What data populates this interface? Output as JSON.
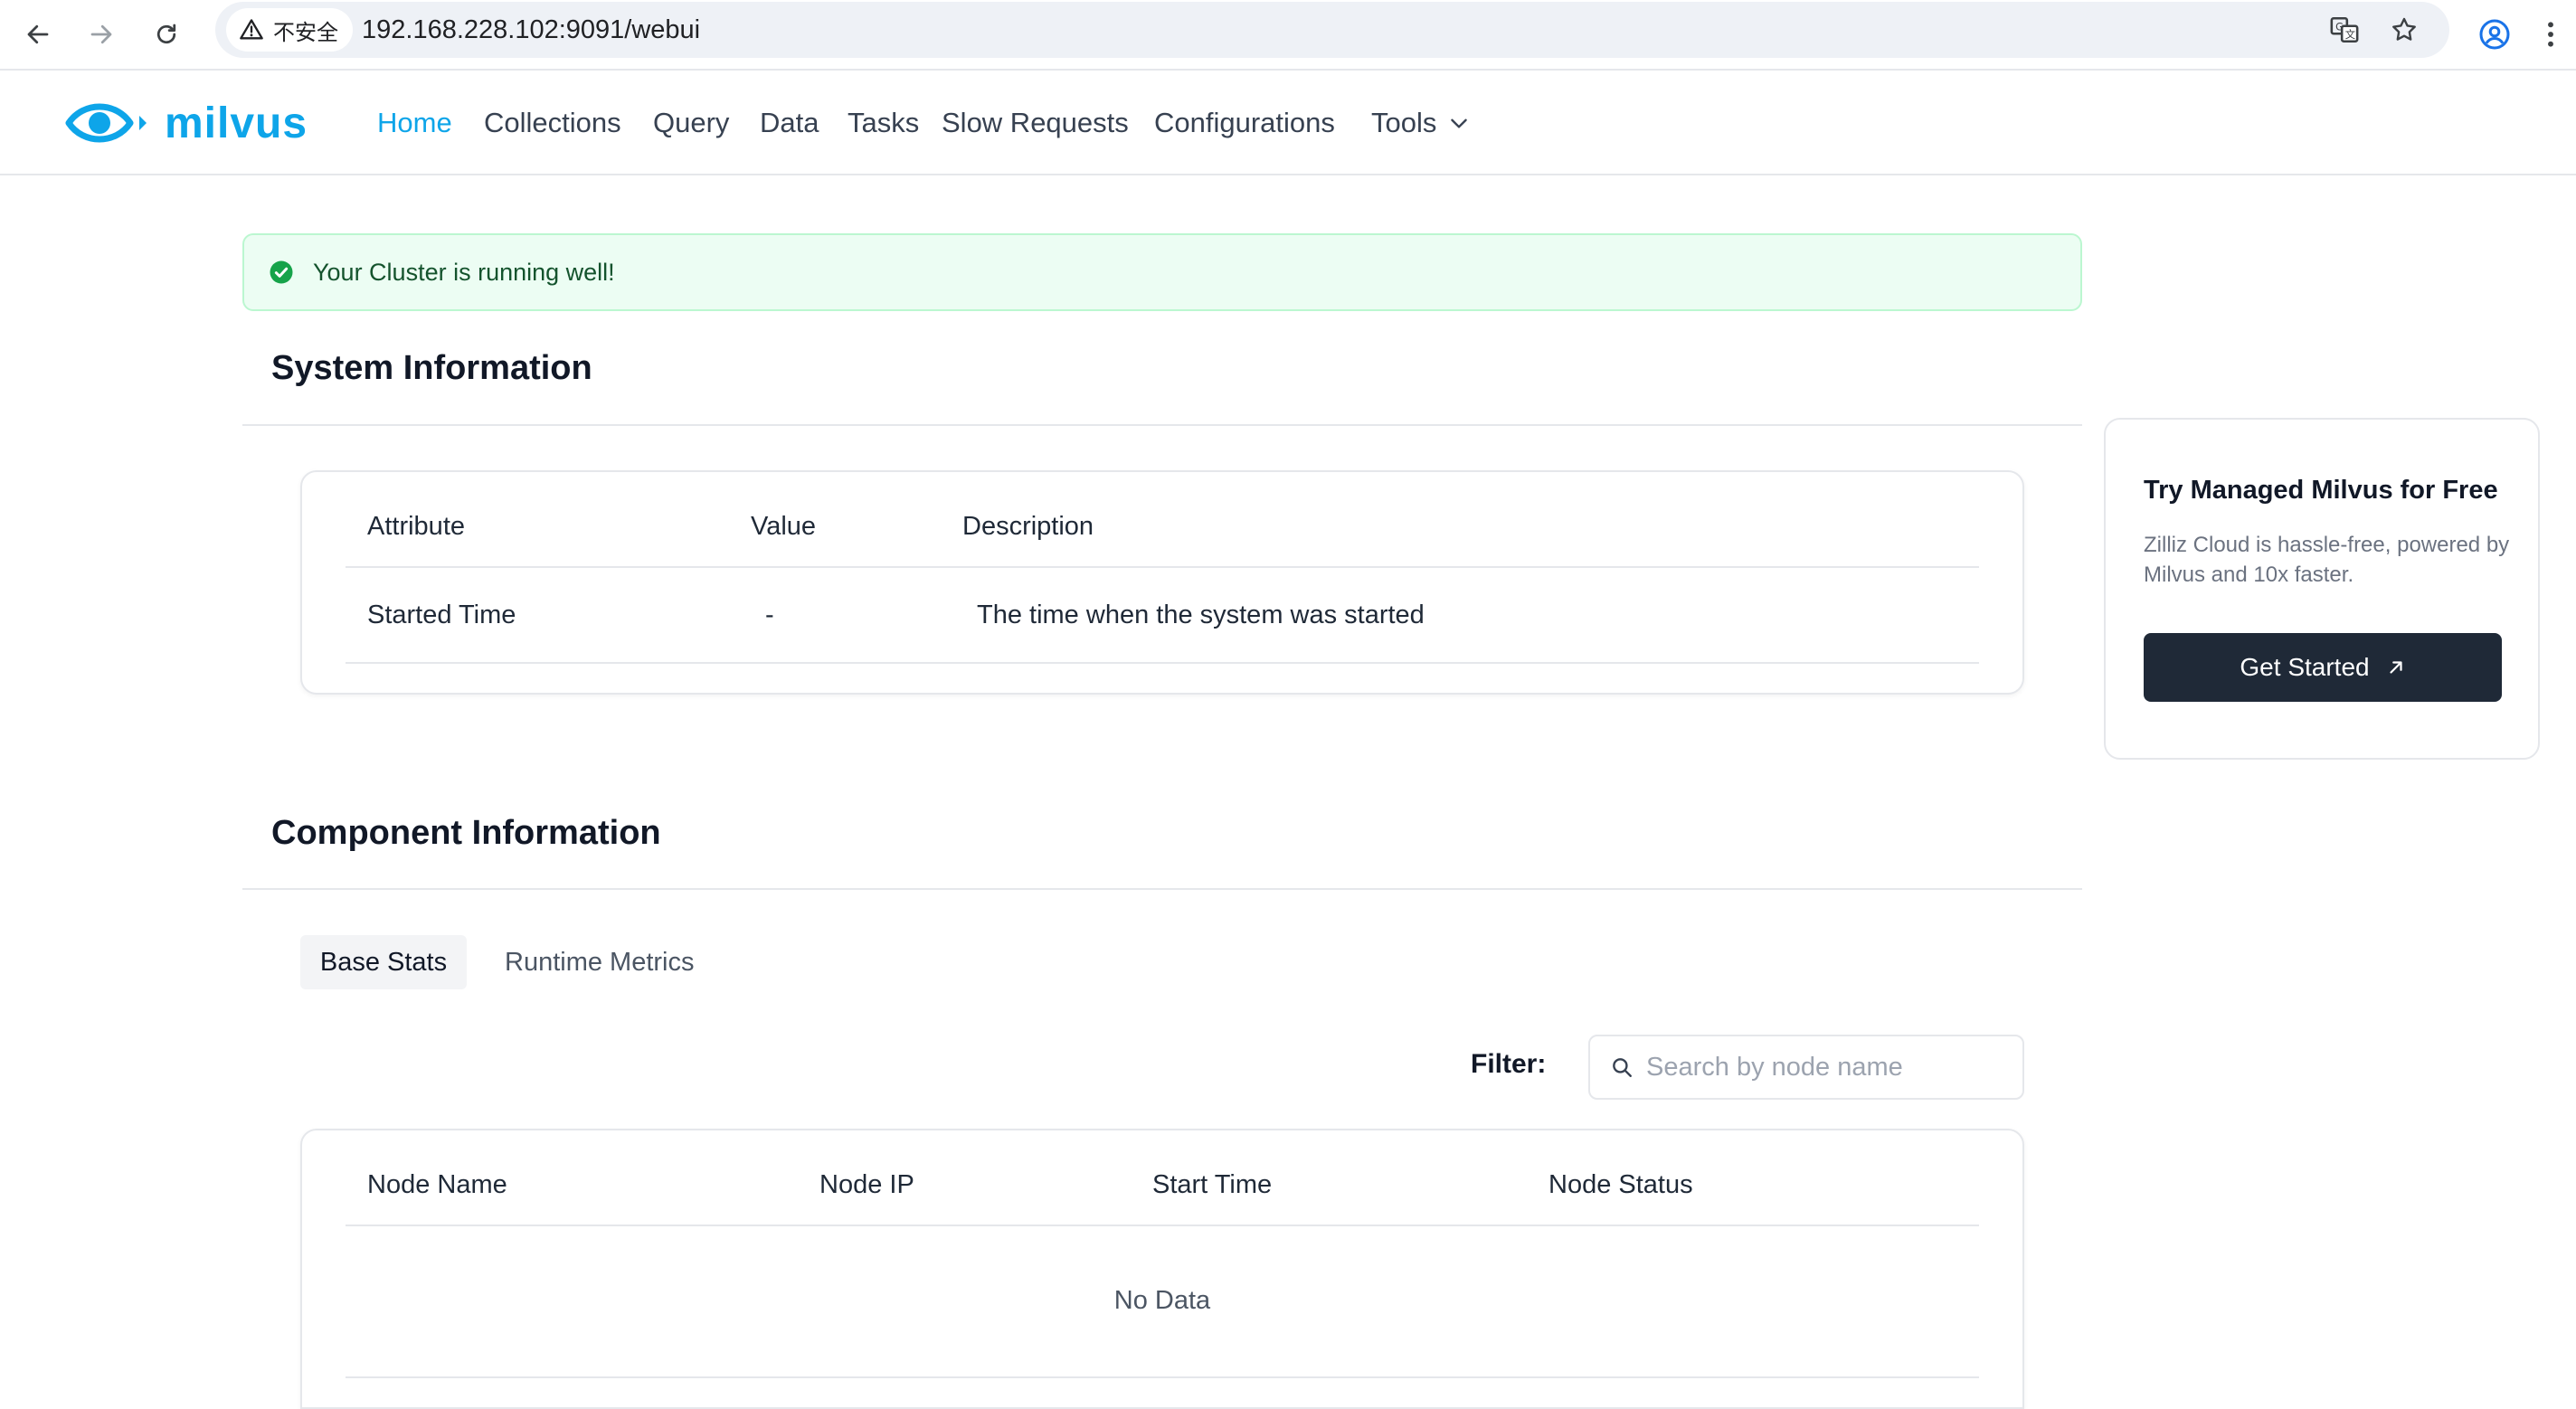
{
  "browser": {
    "security_label": "不安全",
    "url": "192.168.228.102:9091/webui"
  },
  "app": {
    "brand": "milvus",
    "brand_color": "#0ea5e9",
    "nav": [
      {
        "label": "Home",
        "active": true
      },
      {
        "label": "Collections"
      },
      {
        "label": "Query"
      },
      {
        "label": "Data"
      },
      {
        "label": "Tasks"
      },
      {
        "label": "Slow Requests"
      },
      {
        "label": "Configurations"
      },
      {
        "label": "Tools"
      }
    ]
  },
  "alert": {
    "message": "Your Cluster is running well!",
    "color": "#16a34a"
  },
  "system_info": {
    "title": "System Information",
    "columns": [
      "Attribute",
      "Value",
      "Description"
    ],
    "rows": [
      [
        "Started Time",
        "-",
        "The time when the system was started"
      ]
    ]
  },
  "component_info": {
    "title": "Component Information",
    "tabs": [
      "Base Stats",
      "Runtime Metrics"
    ],
    "active_tab": "Base Stats",
    "filter_label": "Filter:",
    "search_placeholder": "Search by node name",
    "columns": [
      "Node Name",
      "Node IP",
      "Start Time",
      "Node Status"
    ],
    "empty_text": "No Data"
  },
  "promo": {
    "title": "Try Managed Milvus for Free",
    "description": "Zilliz Cloud is hassle-free, powered by Milvus and 10x faster.",
    "button_label": "Get Started",
    "button_color": "#1f2937"
  },
  "icons": [
    "back-arrow-icon",
    "forward-arrow-icon",
    "reload-icon",
    "warning-icon",
    "translate-icon",
    "star-icon",
    "profile-icon",
    "more-vertical-icon",
    "milvus-eye-icon",
    "chevron-down-icon",
    "check-circle-icon",
    "search-icon",
    "external-arrow-icon"
  ]
}
